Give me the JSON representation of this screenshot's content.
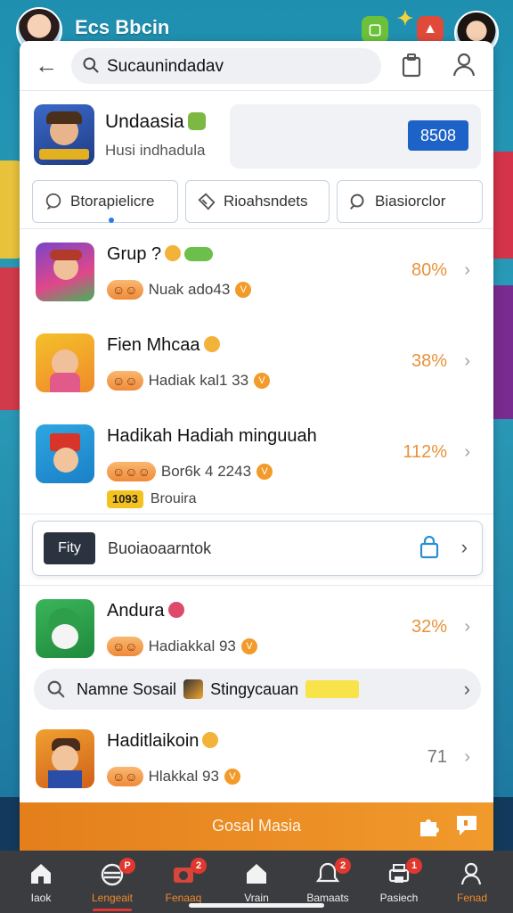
{
  "header": {
    "app_title": "Ecs Bbcin",
    "icons": [
      "green-square-icon",
      "pin-icon",
      "red-bag-icon"
    ]
  },
  "search": {
    "query": "Sucaunindadav",
    "icon": "search-icon"
  },
  "hero": {
    "title": "Undaasia",
    "subtitle": "Husi indhadula",
    "badge_value": "8508"
  },
  "chips": [
    {
      "label": "Btorapielicre",
      "icon": "chat-icon"
    },
    {
      "label": "Rioahsndets",
      "icon": "tag-icon"
    },
    {
      "label": "Biasiorclor",
      "icon": "search-icon"
    }
  ],
  "rows": [
    {
      "title": "Grup ?",
      "meta": "Nuak ado43",
      "pct": "80%"
    },
    {
      "title": "Fien Mhcaa",
      "meta": "Hadiak kal1 33",
      "pct": "38%"
    },
    {
      "title": "Hadikah Hadiah minguuah",
      "meta": "Bor6k 4 2243",
      "pct": "112%",
      "tag": "1093",
      "tag_text": "Brouira"
    },
    {
      "title": "Andura",
      "meta": "Hadiakkal 93",
      "pct": "32%"
    },
    {
      "title": "Haditlaikoin",
      "meta": "Hlakkal 93",
      "pct": "71"
    }
  ],
  "promo_banner": {
    "logo_text": "Fity",
    "text": "Buoiaoaarntok"
  },
  "social": {
    "text1": "Namne Sosail",
    "text2": "Stingycauan"
  },
  "footer_banner": {
    "text": "Gosal Masia"
  },
  "nav": [
    {
      "label": "Iaok",
      "icon": "home-icon"
    },
    {
      "label": "Lengeait",
      "icon": "basket-icon",
      "badge": "P"
    },
    {
      "label": "Fenaaq",
      "icon": "camera-icon",
      "badge": "2"
    },
    {
      "label": "Vrain",
      "icon": "house-icon"
    },
    {
      "label": "Bamaats",
      "icon": "bell-icon",
      "badge": "2"
    },
    {
      "label": "Pasiech",
      "icon": "printer-icon",
      "badge": "1"
    },
    {
      "label": "Fenad",
      "icon": "person-icon"
    }
  ],
  "colors": {
    "accent_orange": "#f08a2a",
    "primary_blue": "#1d62c7",
    "badge_red": "#e0382f"
  }
}
